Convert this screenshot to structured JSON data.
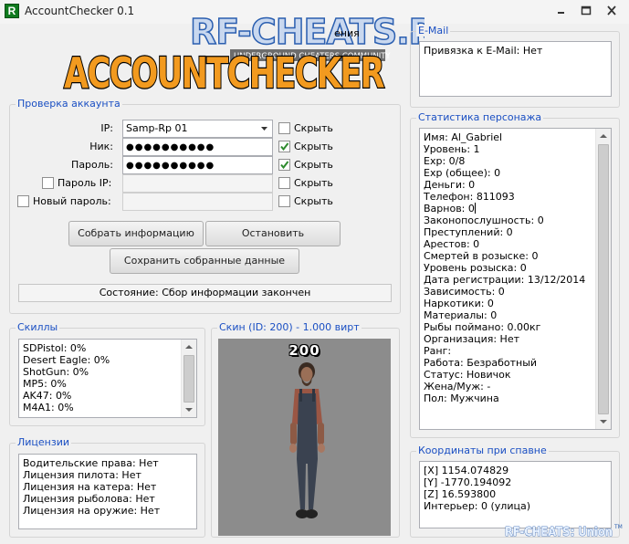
{
  "window": {
    "title": "AccountChecker 0.1",
    "icon_letter": "R",
    "watermark_text": "RF-CHEATS.RU",
    "watermark_sub": "UNDERGROUND CHEATERS COMMUNITY",
    "hidden_fragment": "ения",
    "logo_text": "ACCOUNTCHECKER",
    "footer_logo": "RF-CHEATS: Union",
    "footer_logo_tm": "TM"
  },
  "account_check": {
    "title": "Проверка аккаунта",
    "ip_label": "IP:",
    "ip_value": "Samp-Rp 01",
    "nick_label": "Ник:",
    "nick_value": "●●●●●●●●●●",
    "password_label": "Пароль:",
    "password_value": "●●●●●●●●●●",
    "password_ip_label": "Пароль IP:",
    "new_password_label": "Новый пароль:",
    "hide_label": "Скрыть",
    "hide_states": [
      false,
      true,
      true,
      false,
      false
    ],
    "collect_button": "Собрать информацию",
    "stop_button": "Остановить",
    "save_button": "Сохранить собранные данные",
    "status": "Состояние: Сбор информации закончен"
  },
  "email": {
    "title": "E-Mail",
    "text": "Привязка к E-Mail: Нет"
  },
  "stats": {
    "title": "Статистика персонажа",
    "lines": [
      "Имя: Al_Gabriel",
      "Уровень: 1",
      "Exp: 0/8",
      "Exp (общее): 0",
      "Деньги: 0",
      "Телефон: 811093",
      "Варнов: 0",
      "Законопослушность: 0",
      "Преступлений: 0",
      "Арестов: 0",
      "Смертей в розыске: 0",
      "Уровень розыска: 0",
      "Дата регистрации: 13/12/2014",
      "Зависимость: 0",
      "Наркотики: 0",
      "Материалы: 0",
      "Рыбы поймано: 0.00кг",
      "Организация: Нет",
      "Ранг:",
      "Работа: Безработный",
      "Статус: Новичок",
      "Жена/Муж: -",
      "Пол: Мужчина"
    ]
  },
  "skills": {
    "title": "Скиллы",
    "lines": [
      "SDPistol: 0%",
      "Desert Eagle: 0%",
      "ShotGun: 0%",
      "MP5: 0%",
      "AK47: 0%",
      "M4A1: 0%"
    ]
  },
  "skin": {
    "title": "Скин (ID: 200) - 1.000 вирт",
    "id_label": "200"
  },
  "licenses": {
    "title": "Лицензии",
    "lines": [
      "Водительские права: Нет",
      "Лицензия пилота: Нет",
      "Лицензия на катера: Нет",
      "Лицензия рыболова: Нет",
      "Лицензия на оружие: Нет"
    ]
  },
  "spawn": {
    "title": "Координаты при спавне",
    "lines": [
      "[X] 1154.074829",
      "[Y] -1770.194092",
      "[Z] 16.593800",
      "Интерьер: 0 (улица)"
    ]
  },
  "colors": {
    "group_title": "#1a4fc3",
    "logo_orange": "#f29a1f",
    "watermark_blue": "#2b5fb0",
    "check_green": "#2e8b2e"
  }
}
